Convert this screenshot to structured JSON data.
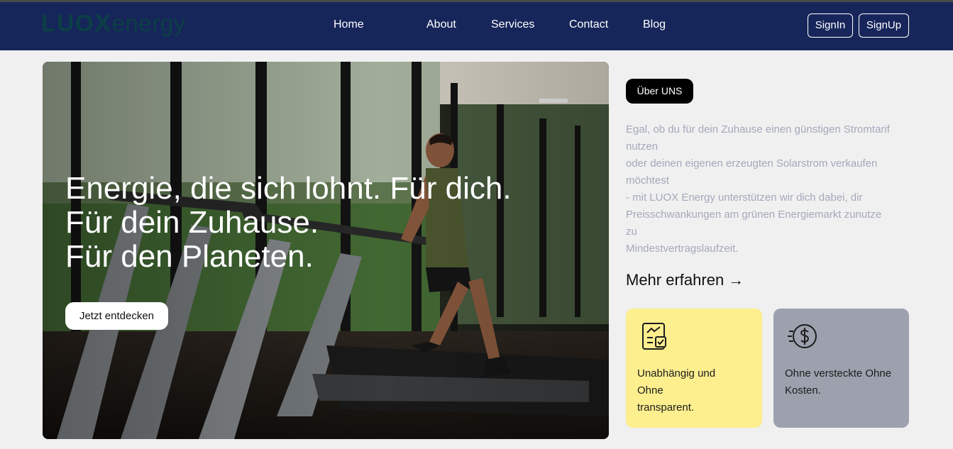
{
  "header": {
    "logo_bold": "LUOX",
    "logo_light": "energy",
    "nav": [
      "Home",
      "About",
      "Services",
      "Contact",
      "Blog"
    ],
    "signin_label": "SignIn",
    "signup_label": "SignUp"
  },
  "hero": {
    "title_lines": [
      "Energie, die sich lohnt. Für dich.",
      "Für dein Zuhause.",
      "Für den Planeten."
    ],
    "cta_label": "Jetzt entdecken"
  },
  "about": {
    "badge": "Über UNS",
    "description_lines": [
      "Egal, ob du für dein Zuhause einen günstigen Stromtarif",
      "nutzen",
      "oder deinen eigenen erzeugten Solarstrom verkaufen",
      "möchtest",
      "- mit LUOX Energy unterstützen wir dich dabei, dir",
      "Preisschwankungen am grünen Energiemarkt zunutze",
      "zu",
      "Mindestvertragslaufzeit."
    ],
    "more_label": "Mehr erfahren →"
  },
  "cards": [
    {
      "icon": "checklist-icon",
      "lines": [
        "Unabhängig und",
        "Ohne",
        "transparent."
      ],
      "color": "#fdee8e"
    },
    {
      "icon": "dollar-coin-icon",
      "lines": [
        "Ohne versteckte Ohne",
        "Kosten."
      ],
      "color": "#9ca1ad"
    }
  ],
  "colors": {
    "navbar": "#17265a",
    "page_bg": "#f0f0f0",
    "logo": "#0b3f45",
    "description_text": "#a4a9bb"
  }
}
